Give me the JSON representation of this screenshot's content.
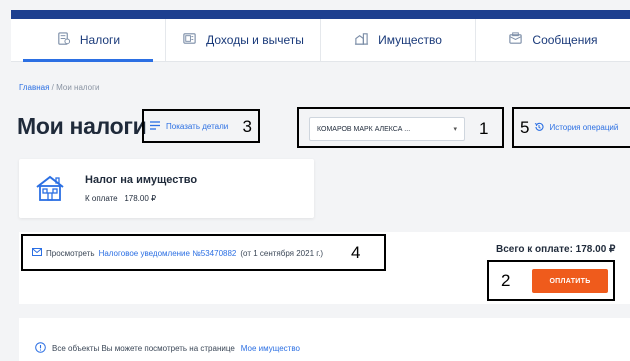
{
  "nav": {
    "tabs": [
      {
        "label": "Налоги",
        "icon": "tax-document-icon",
        "active": true
      },
      {
        "label": "Доходы и вычеты",
        "icon": "income-icon",
        "active": false
      },
      {
        "label": "Имущество",
        "icon": "property-icon",
        "active": false
      },
      {
        "label": "Сообщения",
        "icon": "messages-icon",
        "active": false
      }
    ]
  },
  "breadcrumb": {
    "home": "Главная",
    "separator": " / ",
    "current": "Мои налоги"
  },
  "page": {
    "title": "Мои налоги"
  },
  "details": {
    "label": "Показать детали",
    "callout": "3"
  },
  "taxpayer": {
    "value": "КОМАРОВ МАРК АЛЕКСА ...",
    "callout": "1"
  },
  "history": {
    "label": "История операций",
    "callout": "5"
  },
  "tax_card": {
    "name": "Налог на имущество",
    "due_label": "К оплате",
    "due_amount": "178.00 ₽"
  },
  "notice": {
    "prefix": "Просмотреть",
    "link": "Налоговое уведомление №53470882",
    "suffix": "(от 1 сентября 2021 г.)",
    "callout": "4"
  },
  "total": {
    "label": "Всего к оплате: 178.00 ₽"
  },
  "pay": {
    "label": "ОПЛАТИТЬ",
    "callout": "2"
  },
  "info": {
    "text": "Все объекты Вы можете посмотреть на странице",
    "link": "Мое имущество"
  },
  "colors": {
    "header": "#1d3f8f",
    "accent": "#2b6fe3",
    "pay_button": "#ef5b1c"
  }
}
